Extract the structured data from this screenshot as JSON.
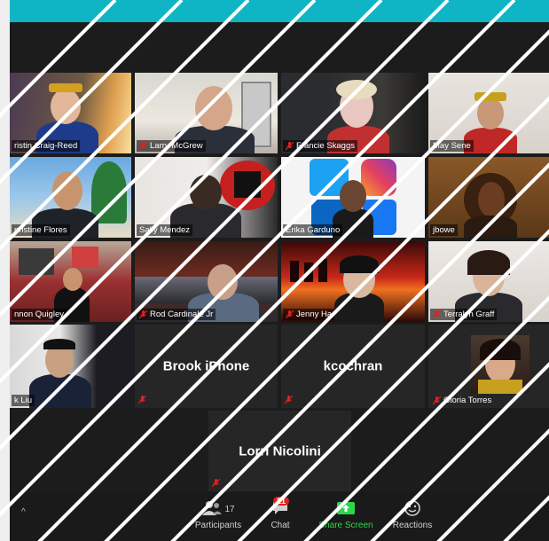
{
  "participants": [
    {
      "name": "ristin Craig-Reed",
      "muted": false
    },
    {
      "name": "Larry McGrew",
      "muted": true
    },
    {
      "name": "Francie Skaggs",
      "muted": true
    },
    {
      "name": "May Sene",
      "muted": false
    },
    {
      "name": "nristine Flores",
      "muted": false
    },
    {
      "name": "Sally Mendez",
      "muted": false
    },
    {
      "name": "Erika Garduno",
      "muted": false
    },
    {
      "name": "jbowe",
      "muted": false
    },
    {
      "name": "nnon Quigley",
      "muted": false
    },
    {
      "name": "Rod Cardinale Jr",
      "muted": true
    },
    {
      "name": "Jenny Ha",
      "muted": true
    },
    {
      "name": "Terralyn Graff",
      "muted": true
    },
    {
      "name": "k Liu",
      "muted": false
    },
    {
      "name": "Brook iPhone",
      "muted": true
    },
    {
      "name": "kcochran",
      "muted": true
    },
    {
      "name": "Gloria Torres",
      "muted": true
    },
    {
      "name": "Lorri Nicolini",
      "muted": true
    }
  ],
  "social_logos": {
    "twitter": "twitter",
    "instagram": "instagram",
    "linkedin": "in",
    "facebook": "f"
  },
  "toolbar": {
    "participants_label": "Participants",
    "participants_count": "17",
    "chat_label": "Chat",
    "chat_badge": "21",
    "share_label": "Share Screen",
    "reactions_label": "Reactions"
  },
  "colors": {
    "top_bar": "#0fb5c5",
    "active_speaker": "#e6f08c",
    "share_green": "#2cd64a",
    "muted_red": "#e02020"
  }
}
